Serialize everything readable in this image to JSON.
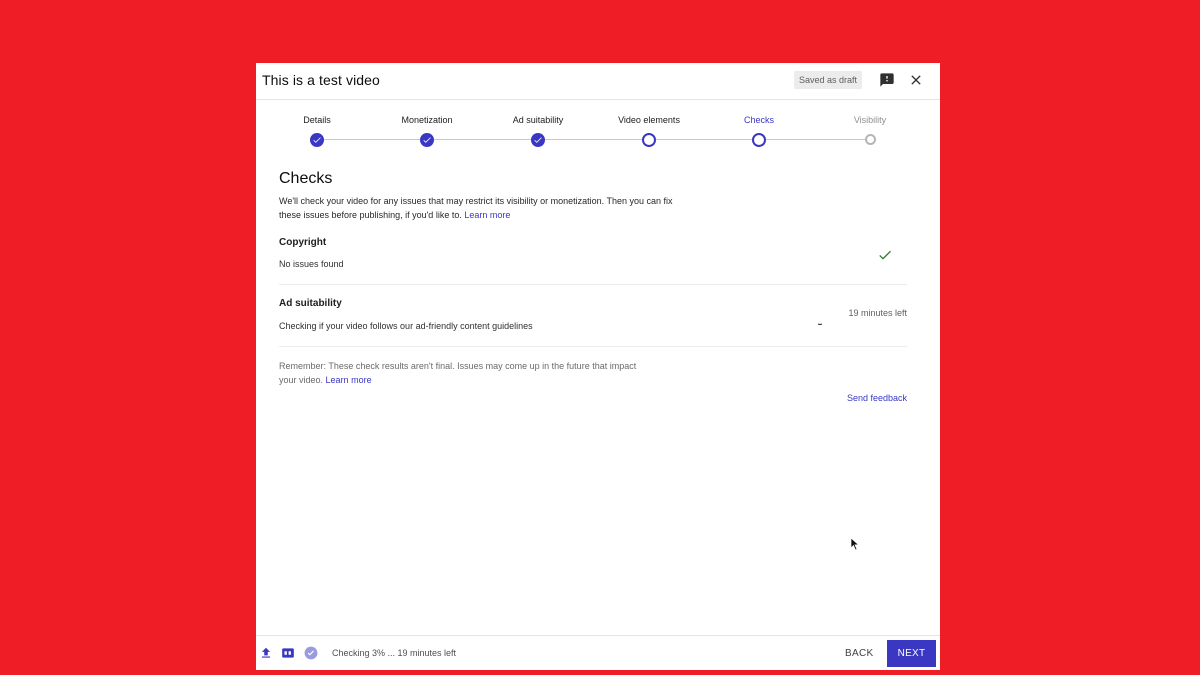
{
  "colors": {
    "background": "#ee1d26",
    "accent": "#3a37c2",
    "success": "#2e7d32"
  },
  "header": {
    "title": "This is a test video",
    "saved_badge": "Saved as draft",
    "icons": [
      "feedback-icon",
      "close-icon"
    ]
  },
  "stepper": {
    "steps": [
      {
        "label": "Details",
        "state": "done"
      },
      {
        "label": "Monetization",
        "state": "done"
      },
      {
        "label": "Ad suitability",
        "state": "done"
      },
      {
        "label": "Video elements",
        "state": "open"
      },
      {
        "label": "Checks",
        "state": "current"
      },
      {
        "label": "Visibility",
        "state": "pending"
      }
    ]
  },
  "main": {
    "title": "Checks",
    "intro_text": "We'll check your video for any issues that may restrict its visibility or monetization. Then you can fix these issues before publishing, if you'd like to.",
    "intro_link": "Learn more",
    "checks": [
      {
        "title": "Copyright",
        "status": "No issues found",
        "indicator": "check-icon"
      },
      {
        "title": "Ad suitability",
        "status": "Checking if your video follows our ad-friendly content guidelines",
        "time_left": "19 minutes left",
        "indicator": "spinner"
      }
    ],
    "remember_text": "Remember: These check results aren't final. Issues may come up in the future that impact your video.",
    "remember_link": "Learn more",
    "send_feedback": "Send feedback"
  },
  "footer": {
    "icons": [
      "upload-icon",
      "hd-icon",
      "check-circle-icon"
    ],
    "status": "Checking 3% ... 19 minutes left",
    "back_label": "BACK",
    "next_label": "NEXT"
  }
}
